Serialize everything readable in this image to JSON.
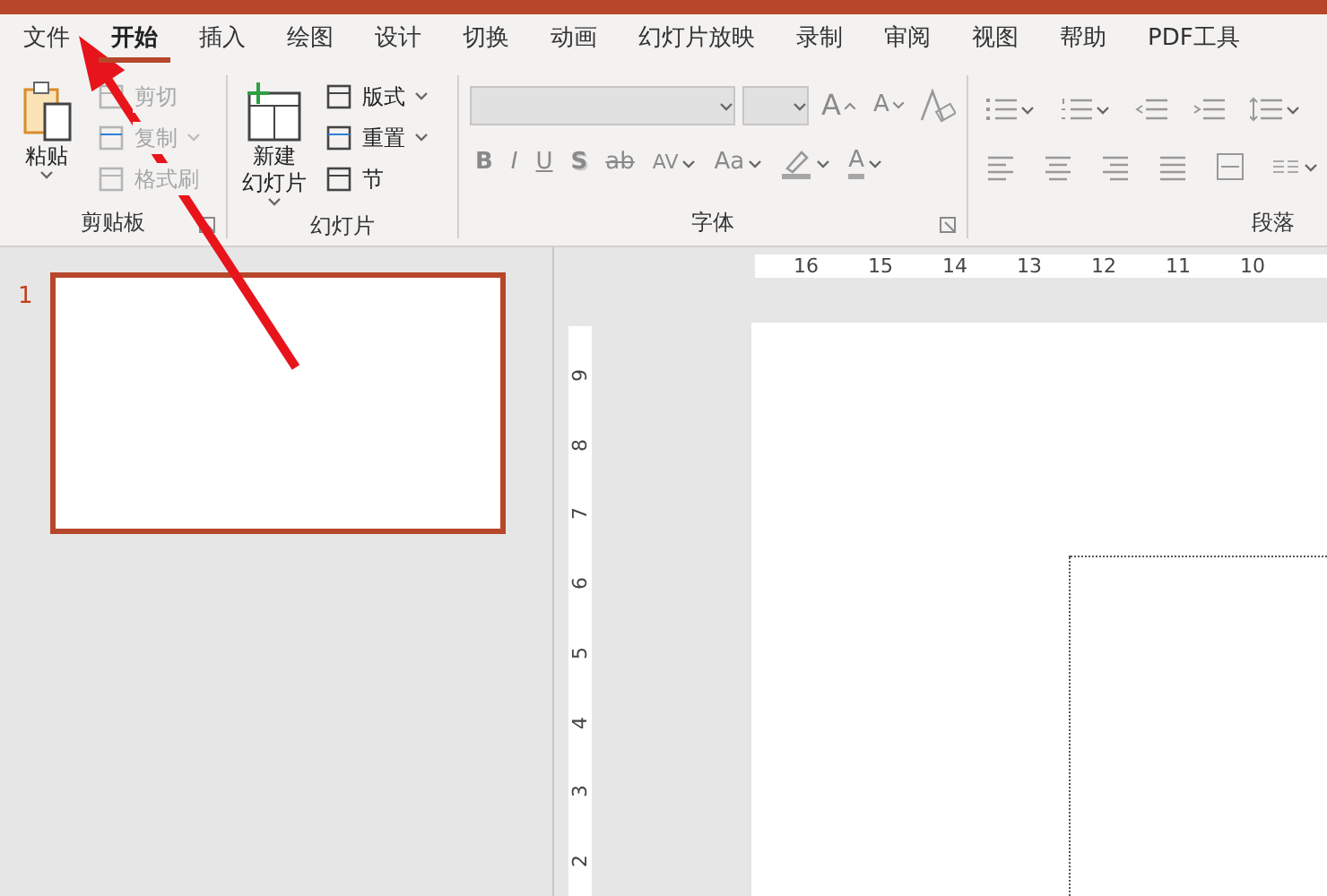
{
  "tabs": [
    {
      "label": "文件",
      "selected": false
    },
    {
      "label": "开始",
      "selected": true
    },
    {
      "label": "插入",
      "selected": false
    },
    {
      "label": "绘图",
      "selected": false
    },
    {
      "label": "设计",
      "selected": false
    },
    {
      "label": "切换",
      "selected": false
    },
    {
      "label": "动画",
      "selected": false
    },
    {
      "label": "幻灯片放映",
      "selected": false
    },
    {
      "label": "录制",
      "selected": false
    },
    {
      "label": "审阅",
      "selected": false
    },
    {
      "label": "视图",
      "selected": false
    },
    {
      "label": "帮助",
      "selected": false
    },
    {
      "label": "PDF工具",
      "selected": false
    }
  ],
  "ribbon": {
    "groups": [
      {
        "kind": "clipboard",
        "label": "剪贴板",
        "large": {
          "lines": [
            "粘贴"
          ]
        },
        "items": [
          {
            "label": "剪切",
            "disabled": true
          },
          {
            "label": "复制",
            "disabled": true
          },
          {
            "label": "格式刷",
            "disabled": true
          }
        ]
      },
      {
        "kind": "slides",
        "label": "幻灯片",
        "large": {
          "lines": [
            "新建",
            "幻灯片"
          ]
        },
        "items": [
          {
            "label": "版式",
            "disabled": false
          },
          {
            "label": "重置",
            "disabled": false
          },
          {
            "label": "节",
            "disabled": false
          }
        ]
      },
      {
        "kind": "font",
        "label": "字体",
        "size_buttons": [
          {
            "label": "A",
            "kind": "grow"
          },
          {
            "label": "A",
            "kind": "shrink"
          }
        ],
        "format_buttons": [
          {
            "label": "B",
            "kind": "bold"
          },
          {
            "label": "I",
            "kind": "italic"
          },
          {
            "label": "U",
            "kind": "underline"
          },
          {
            "label": "S",
            "kind": "shadow"
          },
          {
            "label": "ab",
            "kind": "strike"
          },
          {
            "label": "AV",
            "kind": "spacing"
          },
          {
            "label": "Aa",
            "kind": "case"
          }
        ],
        "color_button": {
          "label": "A"
        }
      },
      {
        "kind": "paragraph",
        "label": "段落"
      }
    ]
  },
  "slides": [
    {
      "number": "1",
      "selected": true
    }
  ],
  "rulers": {
    "horizontal": [
      "16",
      "15",
      "14",
      "13",
      "12",
      "11",
      "10"
    ],
    "vertical": [
      "9",
      "8",
      "7",
      "6",
      "5",
      "4",
      "3",
      "2"
    ]
  }
}
